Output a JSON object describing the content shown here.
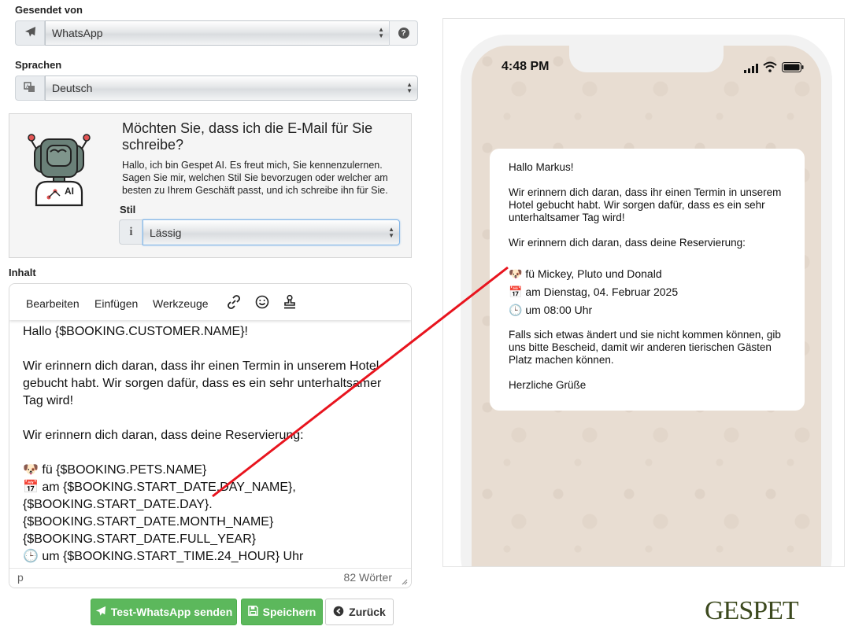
{
  "sender": {
    "label": "Gesendet von",
    "value": "WhatsApp",
    "icon": "paper-plane-icon",
    "help_icon": "question-circle-icon"
  },
  "language": {
    "label": "Sprachen",
    "value": "Deutsch",
    "icon": "translate-icon"
  },
  "ai": {
    "title": "Möchten Sie, dass ich die E-Mail für Sie schreibe?",
    "text": "Hallo, ich bin Gespet AI. Es freut mich, Sie kennenzulernen. Sagen Sie mir, welchen Stil Sie bevorzugen oder welcher am besten zu Ihrem Geschäft passt, und ich schreibe ihn für Sie.",
    "badge": "AI",
    "style_label": "Stil",
    "style_value": "Lässig",
    "info_icon": "info-icon"
  },
  "content": {
    "label": "Inhalt",
    "menu": [
      "Bearbeiten",
      "Einfügen",
      "Werkzeuge"
    ],
    "tool_icons": [
      "link-icon",
      "emoji-icon",
      "stamp-icon"
    ],
    "lines": [
      "Hallo {$BOOKING.CUSTOMER.NAME}!",
      "",
      "Wir erinnern dich daran, dass ihr einen Termin in unserem Hotel gebucht habt. Wir sorgen dafür, dass es ein sehr unterhaltsamer Tag wird!",
      "",
      "Wir erinnern dich daran, dass deine Reservierung:",
      "",
      "🐶 fü {$BOOKING.PETS.NAME}",
      "📅 am {$BOOKING.START_DATE.DAY_NAME}, {$BOOKING.START_DATE.DAY}. {$BOOKING.START_DATE.MONTH_NAME} {$BOOKING.START_DATE.FULL_YEAR}",
      "🕒 um {$BOOKING.START_TIME.24_HOUR} Uhr"
    ],
    "status_path": "p",
    "word_count": "82 Wörter"
  },
  "buttons": {
    "test": "Test-WhatsApp senden",
    "save": "Speichern",
    "back": "Zurück"
  },
  "preview": {
    "time": "4:48 PM",
    "greeting": "Hallo Markus!",
    "paragraph1": "Wir erinnern dich daran, dass ihr einen Termin in unserem Hotel gebucht habt. Wir sorgen dafür, dass es ein sehr unterhaltsamer Tag wird!",
    "paragraph2": "Wir erinnern dich daran, dass deine Reservierung:",
    "line_pets": "🐶 fü Mickey, Pluto und Donald",
    "line_date": "📅 am Dienstag, 04. Februar 2025",
    "line_time": "🕒 um 08:00 Uhr",
    "paragraph3": "Falls sich etwas ändert und sie nicht kommen können, gib uns bitte Bescheid, damit wir anderen tierischen Gästen Platz machen können.",
    "closing": "Herzliche Grüße"
  },
  "brand": {
    "logo": "GESPET",
    "annotation_color": "#e8141e",
    "button_green": "#5cb85c"
  }
}
